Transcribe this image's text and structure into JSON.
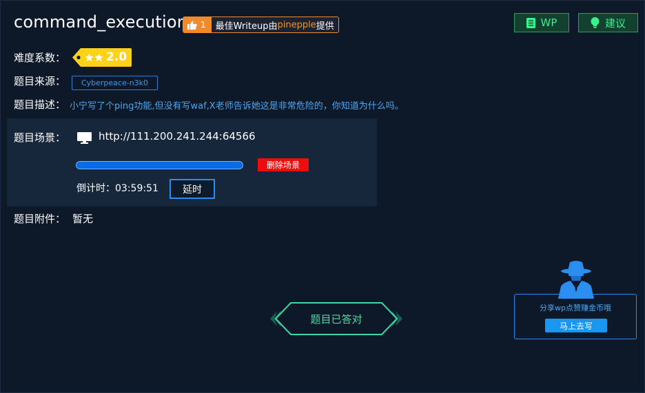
{
  "header": {
    "title": "command_execution",
    "writeup_badge": {
      "count": "1",
      "text_prefix": "最佳Writeup由",
      "author": "pinepple",
      "text_suffix": "提供"
    },
    "wp_button": "WP",
    "advice_button": "建议"
  },
  "info": {
    "difficulty_label": "难度系数：",
    "difficulty_value": "2.0",
    "difficulty_stars": 2,
    "source_label": "题目来源：",
    "source_value": "Cyberpeace-n3k0",
    "description_label": "题目描述：",
    "description_value": "小宁写了个ping功能,但没有写waf,X老师告诉她这是非常危险的，你知道为什么吗。"
  },
  "scene": {
    "label": "题目场景：",
    "url": "http://111.200.241.244:64566",
    "progress_fraction": 1.0,
    "delete_button": "删除场景",
    "countdown_label": "倒计时：",
    "countdown_value": "03:59:51",
    "delay_button": "延时"
  },
  "attachment": {
    "label": "题目附件：",
    "value": "暂无"
  },
  "solved_button": "题目已答对",
  "share": {
    "text": "分享wp点赞赚金币哦",
    "button": "马上去写"
  },
  "colors": {
    "background": "#0d1829",
    "panel": "#16273c",
    "accent_blue": "#2a8df0",
    "accent_green": "#3cf08e",
    "danger": "#ee0d0d",
    "orange": "#f08a2a",
    "difficulty_yellow": "#ffd21a"
  }
}
